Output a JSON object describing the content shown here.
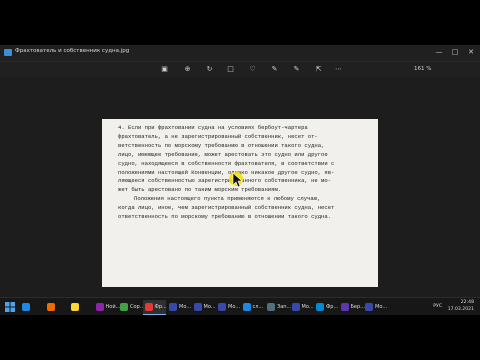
{
  "window": {
    "title": "Фрахтователь и собственник судна.jpg"
  },
  "toolbar": {
    "zoom_label": "161 %"
  },
  "document": {
    "lines": [
      "4. Если   при   фрахтовании  судна на условиях бербоут-чартера",
      "фрахтователь, а  не  зарегистрированный  собственник,  несет от-",
      "ветственность по  морскому  требованию  в отношении такого судна,",
      "лицо,  имеющее требование,  может арестовать это судно или другое",
      "судно,  находящееся в собственности фрахтователя, в соответствии с",
      "положениями настоящей Конвенции,  однако никакое другое судно, яв-",
      "ляющееся собственностью зарегистрированного собственника,  не мо-",
      "жет быть арестовано по таким морским требованиям.",
      "Положения настоящего пункта применяются к  любому случаю,",
      "когда лицо, иное, чем зарегистрированный собственник судна, несет",
      "ответственность по морскому требованию в отношении такого судна."
    ]
  },
  "taskbar": {
    "items": [
      {
        "label": "",
        "color": "#1e88e5"
      },
      {
        "label": "",
        "color": "#ef6c00"
      },
      {
        "label": "",
        "color": "#fdd835"
      },
      {
        "label": "Ной...",
        "color": "#8e24aa"
      },
      {
        "label": "Сор...",
        "color": "#43a047"
      },
      {
        "label": "Фр...",
        "color": "#e53935"
      },
      {
        "label": "Мо...",
        "color": "#3949ab"
      },
      {
        "label": "Мо...",
        "color": "#3949ab"
      },
      {
        "label": "Мо...",
        "color": "#3949ab"
      },
      {
        "label": "сл...",
        "color": "#1e88e5"
      },
      {
        "label": "Зап...",
        "color": "#546e7a"
      },
      {
        "label": "Мо...",
        "color": "#3949ab"
      },
      {
        "label": "Фр...",
        "color": "#0288d1"
      },
      {
        "label": "Бер...",
        "color": "#5e35b1"
      },
      {
        "label": "Мо...",
        "color": "#3949ab"
      }
    ],
    "lang": "РУС",
    "time": "22:48",
    "date": "17.03.2021"
  },
  "colors": {
    "accent": "#7cb7e8",
    "cursor_highlight": "#f5e000"
  }
}
